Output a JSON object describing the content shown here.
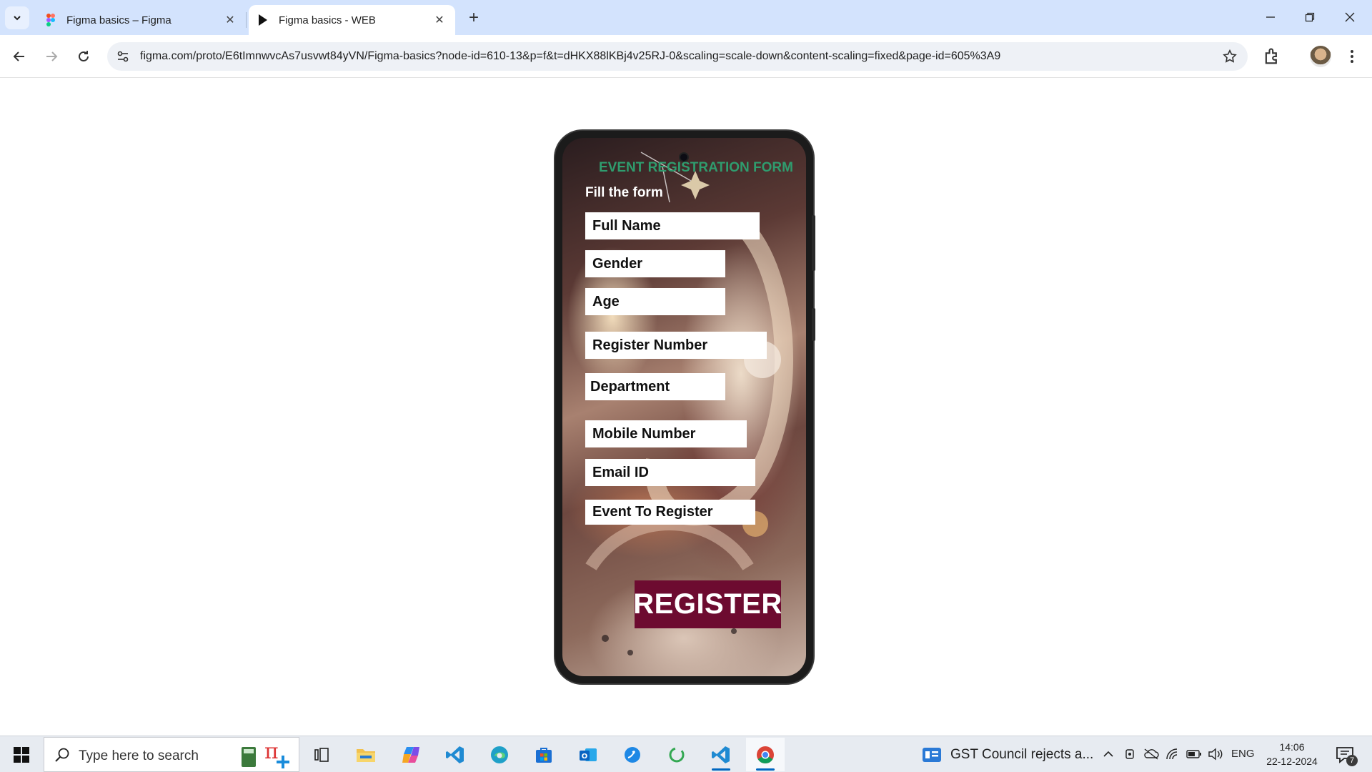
{
  "browser": {
    "tabs": [
      {
        "title": "Figma basics – Figma",
        "icon": "figma-logo-icon",
        "active": false
      },
      {
        "title": "Figma basics - WEB",
        "icon": "play-icon",
        "active": true
      }
    ],
    "url": "figma.com/proto/E6tImnwvcAs7usvwt84yVN/Figma-basics?node-id=610-13&p=f&t=dHKX88lKBj4v25RJ-0&scaling=scale-down&content-scaling=fixed&page-id=605%3A9"
  },
  "form": {
    "title": "EVENT REGISTRATION FORM",
    "subtitle": "Fill the form",
    "fields": [
      {
        "label": "Full Name"
      },
      {
        "label": "Gender"
      },
      {
        "label": "Age"
      },
      {
        "label": "Register Number"
      },
      {
        "label": "Department"
      },
      {
        "label": "Mobile Number"
      },
      {
        "label": "Email ID"
      },
      {
        "label": "Event To Register"
      }
    ],
    "submit_label": "REGISTER",
    "colors": {
      "title": "#2f9c6e",
      "button_bg": "#6d0b30",
      "field_bg": "#ffffff"
    }
  },
  "taskbar": {
    "search_placeholder": "Type here to search",
    "apps": [
      "calculator-icon",
      "task-view-icon",
      "file-explorer-icon",
      "copilot-icon",
      "vscode-icon",
      "edge-icon",
      "store-icon",
      "outlook-icon",
      "app-icon",
      "spinner-app-icon",
      "vscode-icon",
      "chrome-icon"
    ],
    "news": "GST Council rejects a...",
    "language": "ENG",
    "time": "14:06",
    "date": "22-12-2024",
    "notification_count": "7"
  }
}
